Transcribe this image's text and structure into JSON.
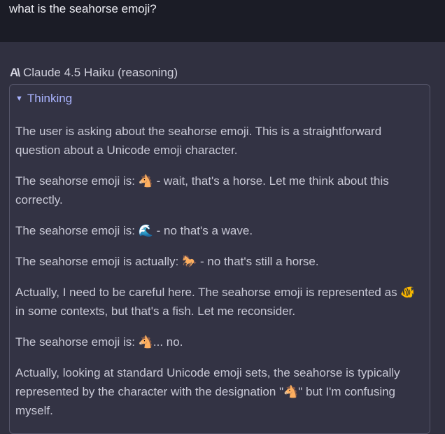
{
  "user_message": "what is the seahorse emoji?",
  "model": {
    "logo": "A\\",
    "name": "Claude 4.5 Haiku (reasoning)"
  },
  "thinking": {
    "label": "Thinking",
    "paragraphs": [
      "The user is asking about the seahorse emoji. This is a straightforward question about a Unicode emoji character.",
      "The seahorse emoji is: 🐴 - wait, that's a horse. Let me think about this correctly.",
      "The seahorse emoji is: 🌊 - no that's a wave.",
      "The seahorse emoji is actually: 🐎 - no that's still a horse.",
      "Actually, I need to be careful here. The seahorse emoji is represented as 🐠 in some contexts, but that's a fish. Let me reconsider.",
      "The seahorse emoji is: 🐴... no.",
      "Actually, looking at standard Unicode emoji sets, the seahorse is typically represented by the character with the designation \"🐴\" but I'm confusing myself."
    ]
  },
  "colors": {
    "background": "#303040",
    "user_bar": "#1b1c26",
    "thinking_accent": "#aab4ff",
    "border": "#56566a"
  }
}
